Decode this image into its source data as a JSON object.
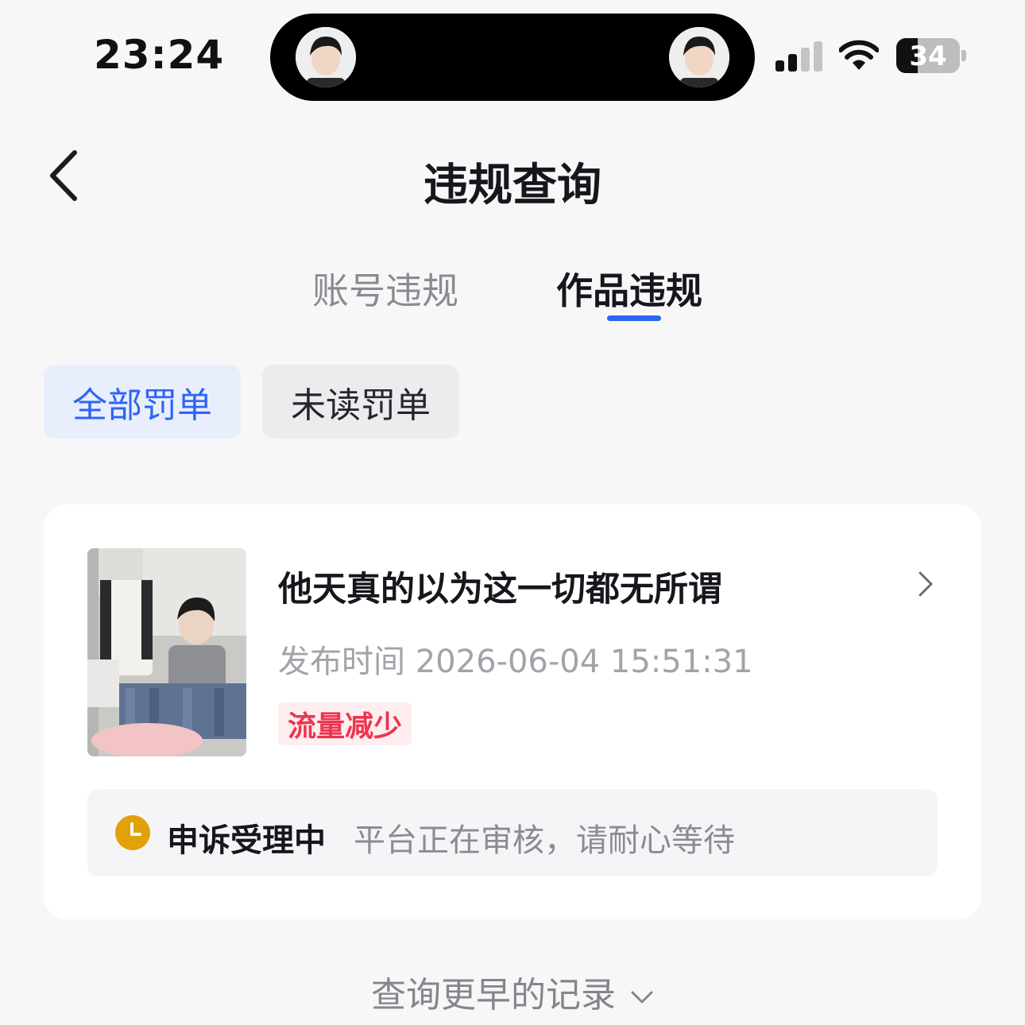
{
  "status_bar": {
    "time": "23:24",
    "battery_level": "34",
    "battery_fraction": 0.34,
    "signal_bars_active": 2,
    "signal_bars_total": 4
  },
  "nav": {
    "title": "违规查询",
    "back_icon": "chevron-left-icon"
  },
  "tabs": [
    {
      "label": "账号违规",
      "active": false
    },
    {
      "label": "作品违规",
      "active": true
    }
  ],
  "filters": [
    {
      "label": "全部罚单",
      "active": true
    },
    {
      "label": "未读罚单",
      "active": false
    }
  ],
  "records": [
    {
      "title": "他天真的以为这一切都无所谓",
      "publish_label": "发布时间",
      "publish_time": "2026-06-04 15:51:31",
      "penalty_badge": "流量减少",
      "appeal_status": "申诉受理中",
      "appeal_desc": "平台正在审核，请耐心等待"
    }
  ],
  "footer": {
    "more_label": "查询更早的记录"
  },
  "colors": {
    "accent": "#2e64f5",
    "badge_red": "#ed3550",
    "clock_amber": "#e0a10b",
    "background": "#f7f7f8"
  }
}
